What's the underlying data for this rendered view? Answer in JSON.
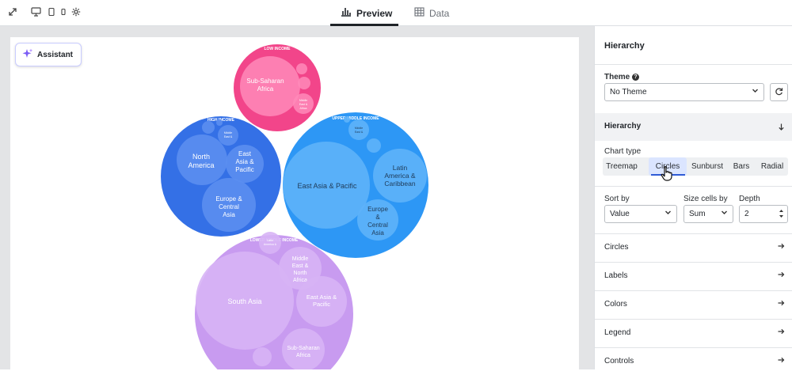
{
  "topbar": {
    "tabs": [
      {
        "label": "Preview",
        "icon": "bar-chart-icon",
        "active": true
      },
      {
        "label": "Data",
        "icon": "table-icon",
        "active": false
      }
    ],
    "icons": [
      "expand-icon",
      "desktop-icon",
      "tablet-icon",
      "phone-icon",
      "settings-icon"
    ]
  },
  "assistant": {
    "label": "Assistant"
  },
  "chart_data": {
    "type": "circle-packing",
    "groups": [
      {
        "name": "LOW INCOME",
        "color": "#f2458a",
        "children": [
          {
            "name": "Sub-Saharan Africa"
          },
          {
            "name": ""
          },
          {
            "name": ""
          },
          {
            "name": "Middle East & North Africa"
          }
        ]
      },
      {
        "name": "HIGH INCOME",
        "color": "#3470e6",
        "children": [
          {
            "name": "North America"
          },
          {
            "name": "East Asia & Pacific"
          },
          {
            "name": "Europe & Central Asia"
          },
          {
            "name": "Latin America & Caribbean"
          },
          {
            "name": "Middle East & North Africa"
          },
          {
            "name": ""
          }
        ]
      },
      {
        "name": "UPPER MIDDLE INCOME",
        "color": "#2d97f5",
        "children": [
          {
            "name": "East Asia & Pacific"
          },
          {
            "name": "Latin America & Caribbean"
          },
          {
            "name": "Europe & Central Asia"
          },
          {
            "name": "Middle East & North Africa"
          },
          {
            "name": ""
          },
          {
            "name": ""
          }
        ]
      },
      {
        "name": "LOWER MIDDLE INCOME",
        "color": "#c89bf0",
        "children": [
          {
            "name": "South Asia"
          },
          {
            "name": "Middle East & North Africa"
          },
          {
            "name": "East Asia & Pacific"
          },
          {
            "name": "Sub-Saharan Africa"
          },
          {
            "name": "Latin America & Caribbean"
          },
          {
            "name": ""
          }
        ]
      }
    ]
  },
  "panel": {
    "title": "Hierarchy",
    "theme": {
      "label": "Theme",
      "value": "No Theme"
    },
    "section_title": "Hierarchy",
    "chart_type": {
      "label": "Chart type",
      "options": [
        "Treemap",
        "Circles",
        "Sunburst",
        "Bars",
        "Radial"
      ],
      "selected": "Circles"
    },
    "sort_by": {
      "label": "Sort by",
      "value": "Value"
    },
    "size_by": {
      "label": "Size cells by",
      "value": "Sum"
    },
    "depth": {
      "label": "Depth",
      "value": "2"
    },
    "sections": [
      "Circles",
      "Labels",
      "Colors",
      "Legend",
      "Controls"
    ]
  }
}
